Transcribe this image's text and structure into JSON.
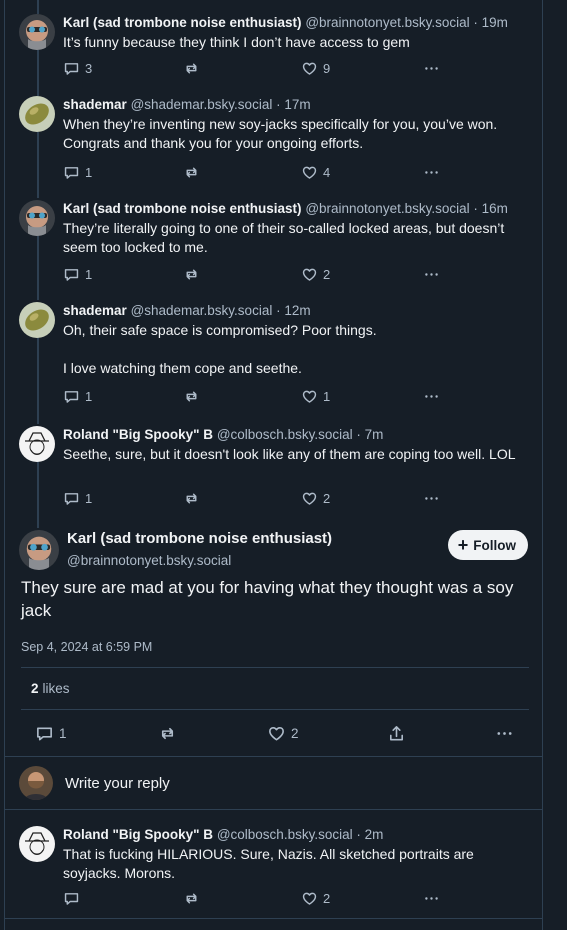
{
  "colors": {
    "background": "#161e27",
    "border": "#2e4052",
    "muted": "#aebbc9",
    "text": "#f1f3f5"
  },
  "posts": [
    {
      "name": "Karl (sad trombone noise enthusiast)",
      "handle": "@brainnotonyet.bsky.social",
      "dot": "·",
      "time": "19m",
      "text": [
        "It’s funny because they think I don’t have access to gem"
      ],
      "replies": "3",
      "reposts": "",
      "likes": "9",
      "avatar": "karl-avatar"
    },
    {
      "name": "shademar",
      "handle": "@shademar.bsky.social",
      "dot": "·",
      "time": "17m",
      "text": [
        "When they’re inventing new soy-jacks specifically for you, you’ve won. Congrats and thank you for your ongoing efforts."
      ],
      "replies": "1",
      "reposts": "",
      "likes": "4",
      "avatar": "shademar-avatar"
    },
    {
      "name": "Karl (sad trombone noise enthusiast)",
      "handle": "@brainnotonyet.bsky.social",
      "dot": "·",
      "time": "16m",
      "text": [
        "They’re literally going to one of their so-called locked areas, but doesn’t seem too locked to me."
      ],
      "replies": "1",
      "reposts": "",
      "likes": "2",
      "avatar": "karl-avatar"
    },
    {
      "name": "shademar",
      "handle": "@shademar.bsky.social",
      "dot": "·",
      "time": "12m",
      "text": [
        "Oh, their safe space is compromised? Poor things.",
        "I love watching them cope and seethe."
      ],
      "replies": "1",
      "reposts": "",
      "likes": "1",
      "avatar": "shademar-avatar"
    },
    {
      "name": "Roland \"Big Spooky\" B",
      "handle": "@colbosch.bsky.social",
      "dot": "·",
      "time": "7m",
      "text": [
        "Seethe, sure, but it doesn't look like any of them are coping too well. LOL"
      ],
      "replies": "1",
      "reposts": "",
      "likes": "2",
      "avatar": "roland-avatar"
    }
  ],
  "main_post": {
    "name": "Karl (sad trombone noise enthusiast)",
    "handle": "@brainnotonyet.bsky.social",
    "follow_label": "Follow",
    "text": "They sure are mad at you for having what they thought was a soy jack",
    "date": "Sep 4, 2024 at 6:59 PM",
    "likes_count": "2",
    "likes_label": "likes",
    "replies": "1",
    "likes": "2"
  },
  "reply_box": {
    "placeholder": "Write your reply"
  },
  "reply": {
    "name": "Roland \"Big Spooky\" B",
    "handle": "@colbosch.bsky.social",
    "dot": "·",
    "time": "2m",
    "text": "That is fucking HILARIOUS. Sure, Nazis. All sketched portraits are soyjacks. Morons.",
    "replies": "",
    "reposts": "",
    "likes": "2"
  }
}
